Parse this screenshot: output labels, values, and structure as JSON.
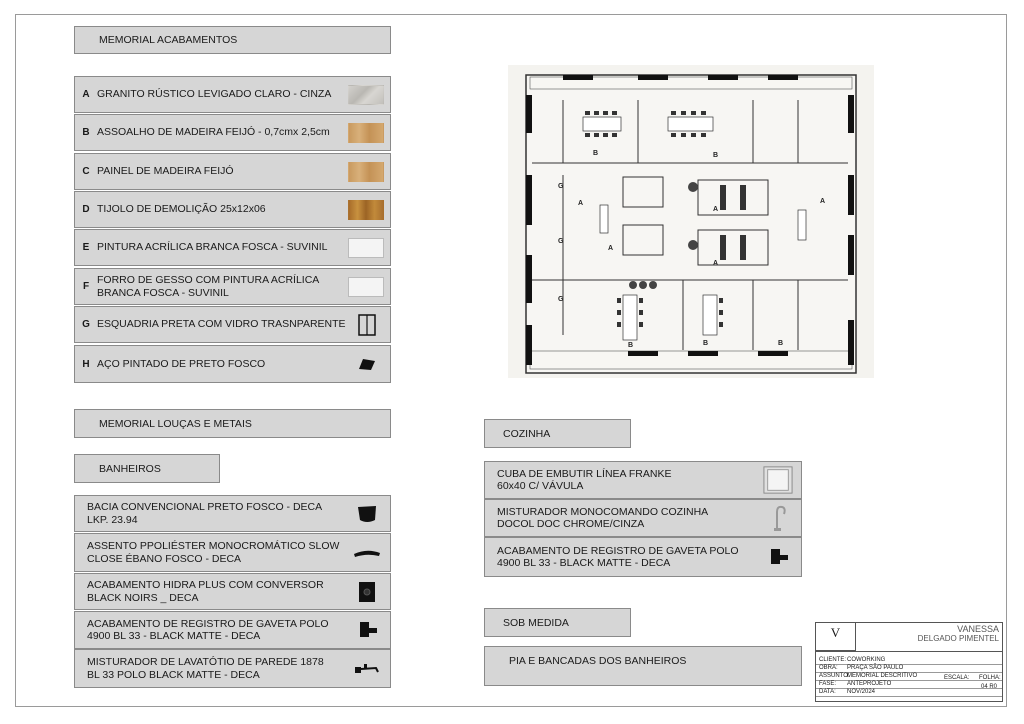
{
  "memorial_acabamentos": {
    "title": "MEMORIAL ACABAMENTOS",
    "items": [
      {
        "letter": "A",
        "text": "GRANITO RÚSTICO  LEVIGADO CLARO - CINZA",
        "swatch": "granite"
      },
      {
        "letter": "B",
        "text": "ASSOALHO DE MADEIRA FEIJÓ - 0,7cmx 2,5cm",
        "swatch": "wood"
      },
      {
        "letter": "C",
        "text": "PAINEL DE MADEIRA FEIJÓ",
        "swatch": "wood"
      },
      {
        "letter": "D",
        "text": "TIJOLO DE DEMOLIÇÃO 25x12x06",
        "swatch": "brick"
      },
      {
        "letter": "E",
        "text": "PINTURA ACRÍLICA BRANCA FOSCA  -  SUVINIL",
        "swatch": "white"
      },
      {
        "letter": "F",
        "text": "FORRO DE GESSO COM PINTURA ACRÍLICA\n BRANCA FOSCA  - SUVINIL",
        "swatch": "white"
      },
      {
        "letter": "G",
        "text": "ESQUADRIA PRETA COM VIDRO TRASNPARENTE",
        "swatch": "window-icon"
      },
      {
        "letter": "H",
        "text": "AÇO PINTADO DE PRETO FOSCO",
        "swatch": "steel-icon"
      }
    ]
  },
  "memorial_loucas": {
    "title": "MEMORIAL LOUÇAS E METAIS",
    "banheiros_title": "BANHEIROS",
    "items": [
      {
        "text": "BACIA  CONVENCIONAL PRETO  FOSCO - DECA\nLKP. 23.94",
        "icon": "toilet-icon"
      },
      {
        "text": "ASSENTO PPOLIÉSTER MONOCROMÁTICO SLOW\nCLOSE ÉBANO FOSCO - DECA",
        "icon": "toilet-seat-icon"
      },
      {
        "text": "ACABAMENTO HIDRA PLUS  COM CONVERSOR\n BLACK NOIRS _ DECA",
        "icon": "flush-plate-icon"
      },
      {
        "text": "ACABAMENTO DE REGISTRO DE GAVETA  POLO\n4900 BL 33 - BLACK MATTE - DECA",
        "icon": "valve-icon"
      },
      {
        "text": "MISTURADOR DE LAVATÓTIO DE PAREDE 1878\n BL 33 POLO BLACK MATTE - DECA",
        "icon": "wall-faucet-icon"
      }
    ]
  },
  "cozinha": {
    "title": "COZINHA",
    "items": [
      {
        "text": "CUBA DE EMBUTIR LÍNEA  FRANKE\n60x40 C/ VÁVULA",
        "icon": "sink-icon"
      },
      {
        "text": "MISTURADOR  MONOCOMANDO COZINHA\nDOCOL DOC CHROME/CINZA",
        "icon": "kitchen-faucet-icon"
      },
      {
        "text": "ACABAMENTO DE REGISTRO DE GAVETA  POLO\n4900 BL 33 - BLACK MATTE - DECA",
        "icon": "valve-icon"
      }
    ]
  },
  "sob_medida": {
    "title": "SOB MEDIDA",
    "items": [
      {
        "text": "PIA E BANCADAS DOS BANHEIROS"
      }
    ]
  },
  "floor_plan": {
    "labels": [
      "A",
      "A",
      "A",
      "A",
      "A",
      "B",
      "B",
      "B",
      "B",
      "B",
      "G",
      "G",
      "G"
    ]
  },
  "title_block": {
    "logo": "V",
    "name_line1": "VANESSA",
    "name_line2": "DELGADO PIMENTEL",
    "rows": [
      {
        "key": "CLIENTE:",
        "value": "COWORKING"
      },
      {
        "key": "OBRA:",
        "value": "PRAÇA SÃO PAULO"
      },
      {
        "key": "ASSUNTO:",
        "value": "MEMORIAL DESCRITIVO"
      },
      {
        "key": "FASE:",
        "value": "ANTEPROJETO"
      },
      {
        "key": "DATA:",
        "value": "NOV/2024"
      }
    ],
    "escala_label": "ESCALA:",
    "folha_label": "FOLHA:",
    "folha_value": "04 R0"
  },
  "colors": {
    "panel": "#d6d6d6",
    "border": "#8a8a8a",
    "wood": "#c9a06b",
    "brick": "#b07a35",
    "granite": "#c8c6c2"
  }
}
